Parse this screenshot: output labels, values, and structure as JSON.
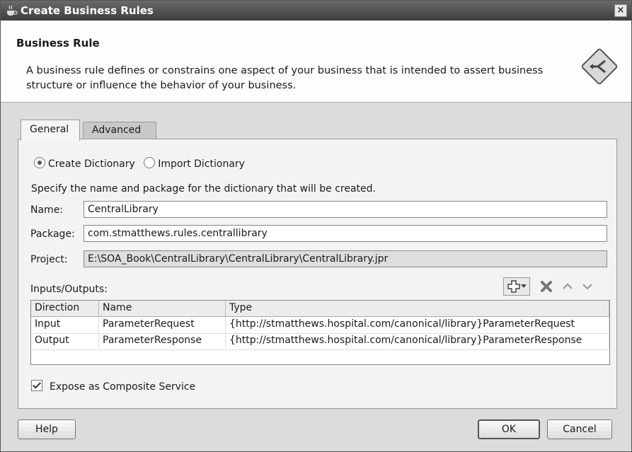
{
  "window": {
    "title": "Create Business Rules",
    "close_glyph": "×",
    "icon": "coffee-cup-icon"
  },
  "header": {
    "title": "Business Rule",
    "description": "A business rule defines or constrains one aspect of your business that is intended to assert business structure or influence the behavior of your business.",
    "logo_icon": "business-rule-icon"
  },
  "tabs": [
    {
      "label": "General",
      "selected": true
    },
    {
      "label": "Advanced",
      "selected": false
    }
  ],
  "dictionary_mode": {
    "options": [
      {
        "label": "Create Dictionary",
        "selected": true
      },
      {
        "label": "Import Dictionary",
        "selected": false
      }
    ]
  },
  "instructions": "Specify the name and package for the dictionary that will be created.",
  "form": {
    "name_label": "Name:",
    "name_value": "CentralLibrary",
    "package_label": "Package:",
    "package_value": "com.stmatthews.rules.centrallibrary",
    "project_label": "Project:",
    "project_value": "E:\\SOA_Book\\CentralLibrary\\CentralLibrary\\CentralLibrary.jpr"
  },
  "io": {
    "label": "Inputs/Outputs:",
    "toolbar": {
      "add_icon": "add-icon",
      "dropdown_icon": "dropdown-arrow-icon",
      "delete_icon": "delete-icon",
      "move_up_icon": "move-up-icon",
      "move_down_icon": "move-down-icon"
    },
    "columns": [
      "Direction",
      "Name",
      "Type"
    ],
    "rows": [
      [
        "Input",
        "ParameterRequest",
        "{http://stmatthews.hospital.com/canonical/library}ParameterRequest"
      ],
      [
        "Output",
        "ParameterResponse",
        "{http://stmatthews.hospital.com/canonical/library}ParameterResponse"
      ]
    ]
  },
  "expose": {
    "label": "Expose as Composite Service",
    "checked": true
  },
  "buttons": {
    "help": "Help",
    "ok": "OK",
    "cancel": "Cancel"
  }
}
